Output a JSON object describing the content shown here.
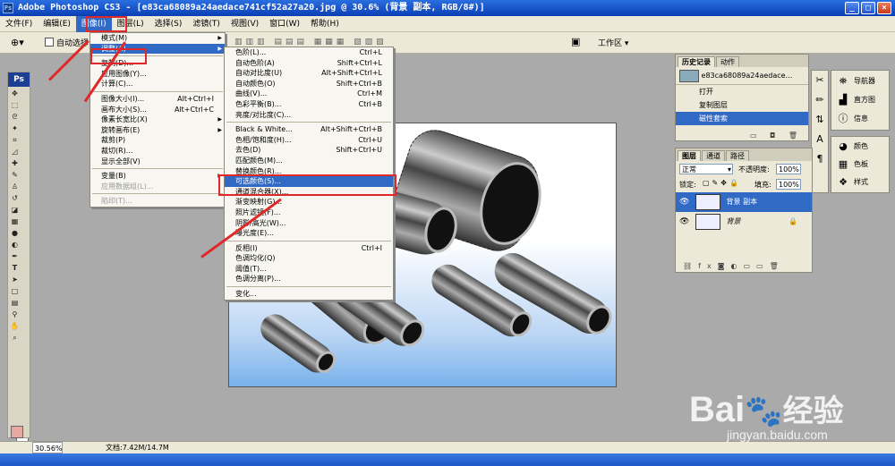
{
  "window": {
    "title": "Adobe Photoshop CS3 - [e83ca68089a24aedace741cf52a27a20.jpg @ 30.6% (背景 副本, RGB/8#)]",
    "app_icon": "Ps"
  },
  "menubar": [
    "文件(F)",
    "编辑(E)",
    "图像(I)",
    "图层(L)",
    "选择(S)",
    "滤镜(T)",
    "视图(V)",
    "窗口(W)",
    "帮助(H)"
  ],
  "options": {
    "auto_select": "自动选择",
    "workspace": "工作区"
  },
  "image_menu": [
    {
      "label": "模式(M)",
      "sub": true
    },
    {
      "label": "调整(A)",
      "sub": true,
      "hl": true
    },
    {
      "sep": true
    },
    {
      "label": "复制(D)..."
    },
    {
      "label": "应用图像(Y)..."
    },
    {
      "label": "计算(C)..."
    },
    {
      "sep": true
    },
    {
      "label": "图像大小(I)...",
      "sc": "Alt+Ctrl+I"
    },
    {
      "label": "画布大小(S)...",
      "sc": "Alt+Ctrl+C"
    },
    {
      "label": "像素长宽比(X)",
      "sub": true
    },
    {
      "label": "旋转画布(E)",
      "sub": true
    },
    {
      "label": "裁剪(P)"
    },
    {
      "label": "裁切(R)..."
    },
    {
      "label": "显示全部(V)"
    },
    {
      "sep": true
    },
    {
      "label": "变量(B)",
      "sub": true
    },
    {
      "label": "应用数据组(L)...",
      "dis": true
    },
    {
      "sep": true
    },
    {
      "label": "陷印(T)...",
      "dis": true
    }
  ],
  "adjust_menu": [
    {
      "label": "色阶(L)...",
      "sc": "Ctrl+L"
    },
    {
      "label": "自动色阶(A)",
      "sc": "Shift+Ctrl+L"
    },
    {
      "label": "自动对比度(U)",
      "sc": "Alt+Shift+Ctrl+L"
    },
    {
      "label": "自动颜色(O)",
      "sc": "Shift+Ctrl+B"
    },
    {
      "label": "曲线(V)...",
      "sc": "Ctrl+M"
    },
    {
      "label": "色彩平衡(B)...",
      "sc": "Ctrl+B"
    },
    {
      "label": "亮度/对比度(C)..."
    },
    {
      "sep": true
    },
    {
      "label": "Black & White...",
      "sc": "Alt+Shift+Ctrl+B"
    },
    {
      "label": "色相/饱和度(H)...",
      "sc": "Ctrl+U"
    },
    {
      "label": "去色(D)",
      "sc": "Shift+Ctrl+U"
    },
    {
      "label": "匹配颜色(M)..."
    },
    {
      "label": "替换颜色(R)..."
    },
    {
      "label": "可选颜色(S)...",
      "hl": true
    },
    {
      "label": "通道混合器(X)..."
    },
    {
      "label": "渐变映射(G)..."
    },
    {
      "label": "照片滤镜(F)..."
    },
    {
      "label": "阴影/高光(W)..."
    },
    {
      "label": "曝光度(E)..."
    },
    {
      "sep": true
    },
    {
      "label": "反相(I)",
      "sc": "Ctrl+I"
    },
    {
      "label": "色调均化(Q)"
    },
    {
      "label": "阈值(T)..."
    },
    {
      "label": "色调分离(P)..."
    },
    {
      "sep": true
    },
    {
      "label": "变化..."
    }
  ],
  "history": {
    "tabs": [
      "历史记录",
      "动作"
    ],
    "snapshot": "e83ca68089a24aedace...",
    "items": [
      "打开",
      "复制图层",
      "磁性套索"
    ]
  },
  "layers": {
    "tabs": [
      "图层",
      "通道",
      "路径"
    ],
    "blend_mode": "正常",
    "opacity_label": "不透明度:",
    "opacity": "100%",
    "lock_label": "锁定:",
    "fill_label": "填充:",
    "fill": "100%",
    "items": [
      "背景 副本",
      "背景"
    ]
  },
  "right_panels": {
    "group1": [
      "导航器",
      "直方图",
      "信息"
    ],
    "group2": [
      "颜色",
      "色板",
      "样式"
    ]
  },
  "status": {
    "zoom": "30.56%",
    "doc": "文档:7.42M/14.7M"
  },
  "watermark": {
    "brand": "Bai",
    "brand_cn": "经验",
    "url": "jingyan.baidu.com"
  },
  "colors": {
    "highlight": "#316ac5",
    "annotation_red": "#e0282a",
    "foreground": "#e8a8a0",
    "background": "#ffffff"
  }
}
